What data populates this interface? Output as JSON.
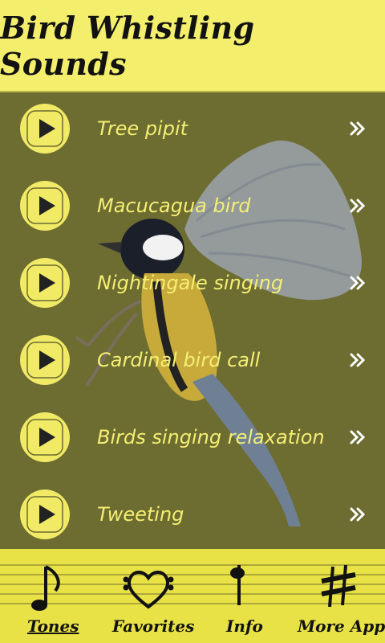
{
  "header": {
    "title": "Bird Whistling Sounds"
  },
  "list": [
    {
      "label": "Tree pipit"
    },
    {
      "label": "Macucagua bird"
    },
    {
      "label": "Nightingale singing"
    },
    {
      "label": "Cardinal bird call"
    },
    {
      "label": "Birds singing relaxation"
    },
    {
      "label": "Tweeting"
    }
  ],
  "tabs": [
    {
      "label": "Tones",
      "icon": "eighth-note-icon",
      "active": true
    },
    {
      "label": "Favorites",
      "icon": "heart-clef-icon",
      "active": false
    },
    {
      "label": "Info",
      "icon": "quarter-note-icon",
      "active": false
    },
    {
      "label": "More Apps",
      "icon": "sharp-icon",
      "active": false
    }
  ],
  "colors": {
    "header_bg": "#f4ee6d",
    "main_bg": "#6d6c31",
    "label_text": "#f4ef74",
    "play_button": "#f1ea66",
    "tab_bar_bg": "#e8e247"
  }
}
